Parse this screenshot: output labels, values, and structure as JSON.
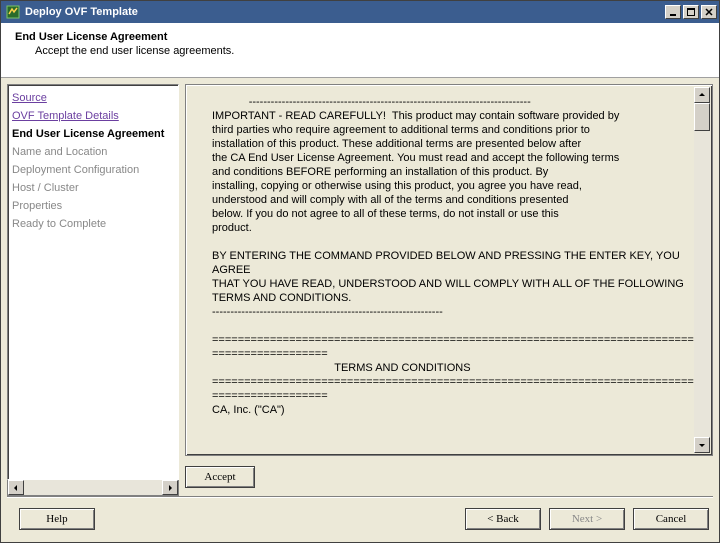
{
  "window": {
    "title": "Deploy OVF Template"
  },
  "header": {
    "title": "End User License Agreement",
    "subtitle": "Accept the end user license agreements."
  },
  "nav": {
    "items": [
      {
        "label": "Source",
        "state": "link"
      },
      {
        "label": "OVF Template Details",
        "state": "link"
      },
      {
        "label": "End User License Agreement",
        "state": "current"
      },
      {
        "label": "Name and Location",
        "state": "disabled"
      },
      {
        "label": "Deployment Configuration",
        "state": "disabled"
      },
      {
        "label": "Host / Cluster",
        "state": "disabled"
      },
      {
        "label": "Properties",
        "state": "disabled"
      },
      {
        "label": "Ready to Complete",
        "state": "disabled"
      }
    ]
  },
  "eula": {
    "text": "            -----------------------------------------------------------------------------\nIMPORTANT - READ CAREFULLY!  This product may contain software provided by\nthird parties who require agreement to additional terms and conditions prior to\ninstallation of this product. These additional terms are presented below after\nthe CA End User License Agreement. You must read and accept the following terms\nand conditions BEFORE performing an installation of this product. By\ninstalling, copying or otherwise using this product, you agree you have read,\nunderstood and will comply with all of the terms and conditions presented\nbelow. If you do not agree to all of these terms, do not install or use this\nproduct.\n\nBY ENTERING THE COMMAND PROVIDED BELOW AND PRESSING THE ENTER KEY, YOU AGREE\nTHAT YOU HAVE READ, UNDERSTOOD AND WILL COMPLY WITH ALL OF THE FOLLOWING\nTERMS AND CONDITIONS.\n---------------------------------------------------------------\n\n==============================================================================\n==================\n                                        TERMS AND CONDITIONS\n==============================================================================\n==================\nCA, Inc. (\"CA\")"
  },
  "buttons": {
    "accept": "Accept",
    "help": "Help",
    "back": "< Back",
    "next": "Next >",
    "cancel": "Cancel"
  }
}
